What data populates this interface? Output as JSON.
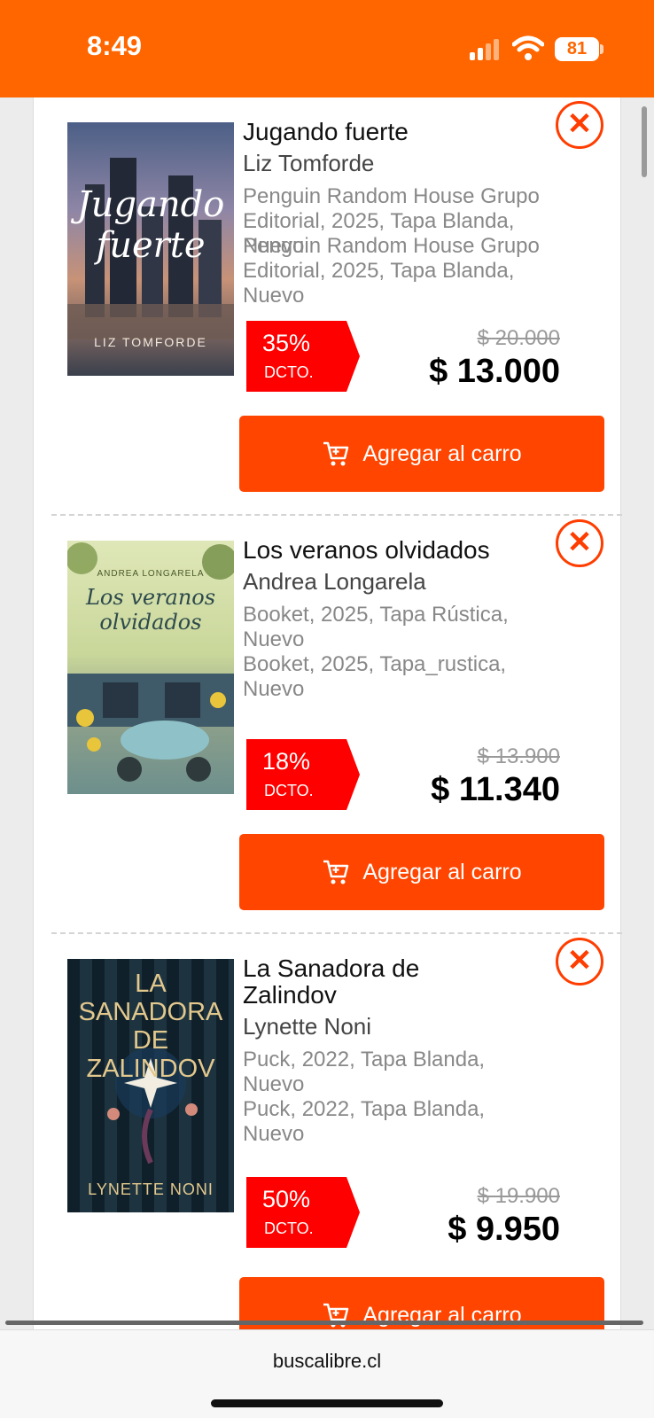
{
  "status_bar": {
    "time": "8:49",
    "battery": "81"
  },
  "items": [
    {
      "title": "Jugando fuerte",
      "author": "Liz Tomforde",
      "details_1": "Penguin Random House Grupo Editorial, 2025, Tapa Blanda, Nuevo",
      "details_2": "Penguin Random House Grupo Editorial, 2025, Tapa Blanda, Nuevo",
      "discount_pct": "35%",
      "discount_label": "DCTO.",
      "old_price": "$ 20.000",
      "new_price": "$ 13.000",
      "cover_title": "Jugando fuerte",
      "cover_author": "LIZ TOMFORDE"
    },
    {
      "title": "Los veranos olvidados",
      "author": "Andrea Longarela",
      "details_1": "Booket, 2025, Tapa Rústica, Nuevo",
      "details_2": "Booket, 2025, Tapa_rustica, Nuevo",
      "discount_pct": "18%",
      "discount_label": "DCTO.",
      "old_price": "$ 13.900",
      "new_price": "$ 11.340",
      "cover_title": "Los veranos olvidados",
      "cover_author": "ANDREA LONGARELA"
    },
    {
      "title": "La Sanadora de Zalindov",
      "author": "Lynette Noni",
      "details_1": "Puck, 2022, Tapa Blanda, Nuevo",
      "details_2": "Puck, 2022, Tapa Blanda, Nuevo",
      "discount_pct": "50%",
      "discount_label": "DCTO.",
      "old_price": "$ 19.900",
      "new_price": "$ 9.950",
      "cover_title": "LA SANADORA DE ZALINDOV",
      "cover_author": "LYNETTE NONI"
    }
  ],
  "add_to_cart_label": "Agregar al carro",
  "remove_symbol": "✕",
  "browser": {
    "url": "buscalibre.cl"
  },
  "colors": {
    "brand": "#ff6600",
    "button": "#ff4500",
    "discount": "#ff0000"
  },
  "icons": [
    "signal-icon",
    "wifi-icon",
    "battery-icon",
    "close-icon",
    "cart-icon"
  ]
}
